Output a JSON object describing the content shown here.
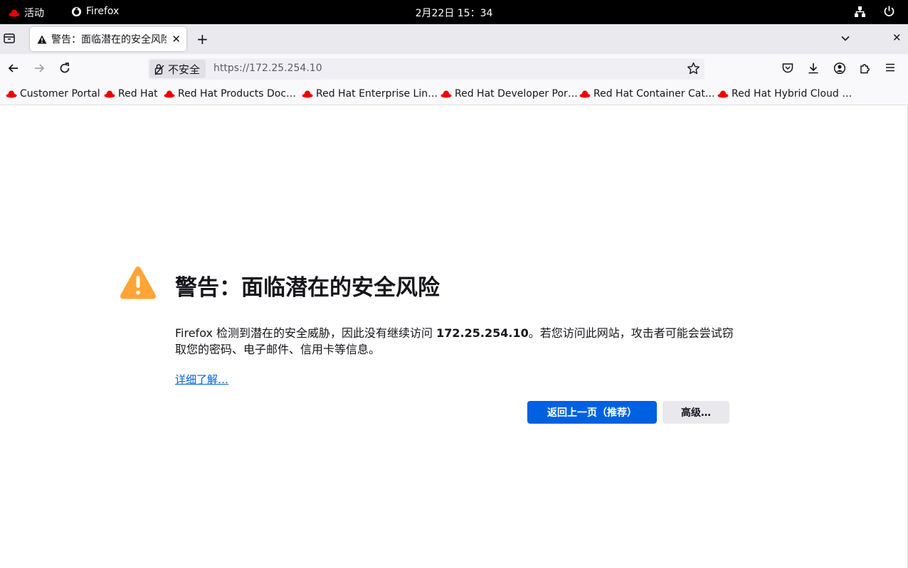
{
  "topbar": {
    "activities": "活动",
    "app_name": "Firefox",
    "clock": "2月22日  15：34"
  },
  "tab": {
    "title": "警告：面临潜在的安全风险"
  },
  "urlbar": {
    "identity_label": "不安全",
    "url": "https://172.25.254.10"
  },
  "bookmarks": [
    "Customer Portal",
    "Red Hat",
    "Red Hat Products Doc…",
    "Red Hat Enterprise Lin…",
    "Red Hat Developer Por…",
    "Red Hat Container Cat…",
    "Red Hat Hybrid Cloud …"
  ],
  "error": {
    "title": "警告：面临潜在的安全风险",
    "desc_before": "Firefox 检测到潜在的安全威胁，因此没有继续访问 ",
    "host": "172.25.254.10",
    "desc_after": "。若您访问此网站，攻击者可能会尝试窃取您的密码、电子邮件、信用卡等信息。",
    "learn_more": "详细了解…",
    "go_back": "返回上一页（推荐）",
    "advanced": "高级…"
  },
  "colors": {
    "accent": "#0061e0",
    "warning": "#ffa436",
    "redhat": "#ee0000"
  }
}
